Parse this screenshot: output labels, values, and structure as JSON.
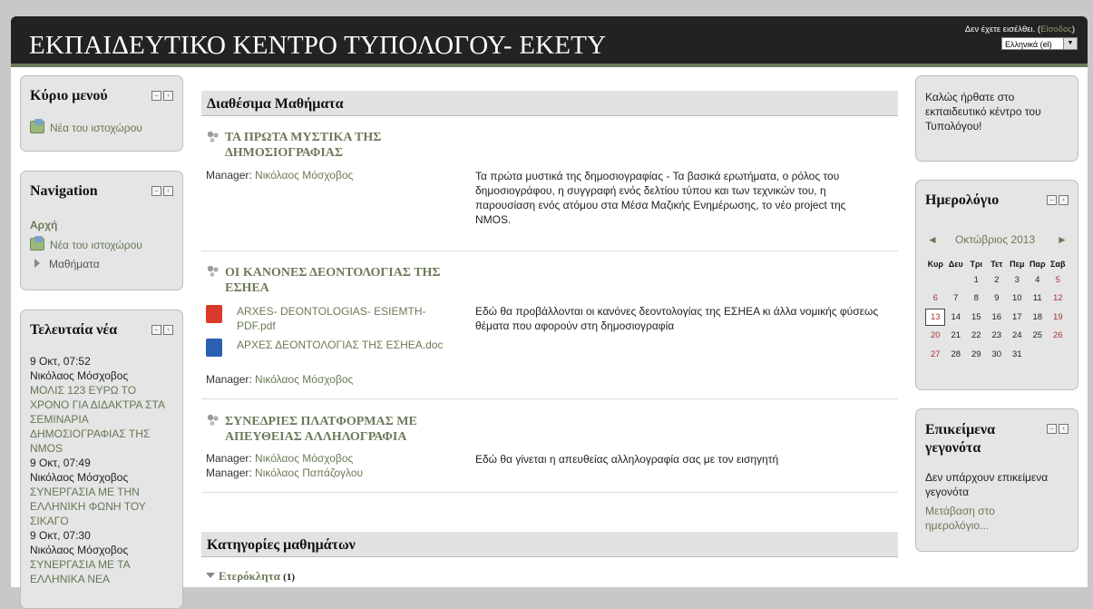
{
  "header": {
    "title": "ΕΚΠΑΙΔΕΥΤΙΚΟ ΚΕΝΤΡΟ ΤΥΠΟΛΟΓΟΥ- ΕΚΕΤΥ",
    "login_text": "Δεν έχετε εισέλθει. (",
    "login_link": "Είσοδος",
    "login_close": ")",
    "language": "Ελληνικά (el)"
  },
  "main_menu": {
    "title": "Κύριο μενού",
    "items": [
      "Νέα του ιστοχώρου"
    ]
  },
  "navigation": {
    "title": "Navigation",
    "home": "Αρχή",
    "items": [
      "Νέα του ιστοχώρου",
      "Μαθήματα"
    ]
  },
  "latest_news": {
    "title": "Τελευταία νέα",
    "posts": [
      {
        "date": "9 Οκτ, 07:52",
        "author": "Νικόλαος Μόσχοβος",
        "headline": "ΜΟΛΙΣ 123 ΕΥΡΩ ΤΟ ΧΡΟΝΟ ΓΙΑ ΔΙΔΑΚΤΡΑ ΣΤΑ ΣΕΜΙΝΑΡΙΑ ΔΗΜΟΣΙΟΓΡΑΦΙΑΣ ΤΗΣ ΝΜΟS"
      },
      {
        "date": "9 Οκτ, 07:49",
        "author": "Νικόλαος Μόσχοβος",
        "headline": "ΣΥΝΕΡΓΑΣΙΑ ΜΕ ΤΗΝ ΕΛΛΗΝΙΚΗ ΦΩΝΗ ΤΟΥ ΣΙΚΑΓΟ"
      },
      {
        "date": "9 Οκτ, 07:30",
        "author": "Νικόλαος Μόσχοβος",
        "headline": "ΣΥΝΕΡΓΑΣΙΑ ΜΕ ΤΑ ΕΛΛΗΝΙΚΑ ΝΕΑ"
      }
    ]
  },
  "courses": {
    "heading": "Διαθέσιμα Μαθήματα",
    "items": [
      {
        "title": "ΤΑ ΠΡΩΤΑ ΜΥΣΤΙΚΑ ΤΗΣ ΔΗΜΟΣΙΟΓΡΑΦΙΑΣ",
        "manager_label": "Manager:",
        "managers": [
          "Νικόλαος Μόσχοβος"
        ],
        "summary": "Τα πρώτα μυστικά της δημοσιογραφίας - Τα βασικά ερωτήματα, ο ρόλος του δημοσιογράφου, η συγγραφή ενός δελτίου τύπου και των τεχνικών του, η παρουσίαση ενός ατόμου στα Μέσα Μαζικής Ενημέρωσης, το νέο project της NMOS."
      },
      {
        "title": "ΟΙ ΚΑΝΟΝΕΣ ΔΕΟΝΤΟΛΟΓΙΑΣ ΤΗΣ ΕΣΗΕΑ",
        "files": [
          "ARXES- DEONTOLOGIAS- ESIEMTH-PDF.pdf",
          "ΑΡΧΕΣ ΔΕΟΝΤΟΛΟΓΙΑΣ ΤΗΣ ΕΣΗΕΑ.doc"
        ],
        "manager_label": "Manager:",
        "managers": [
          "Νικόλαος Μόσχοβος"
        ],
        "summary": "Εδώ θα προβάλλονται οι κανόνες δεοντολογίας της ΕΣΗΕΑ κι άλλα νομικής φύσεως θέματα που αφορούν στη δημοσιογραφία"
      },
      {
        "title": "ΣΥΝΕΔΡΙΕΣ ΠΛΑΤΦΟΡΜΑΣ ΜΕ ΑΠΕΥΘΕΙΑΣ ΑΛΛΗΛΟΓΡΑΦΙΑ",
        "manager_label": "Manager:",
        "managers": [
          "Νικόλαος Μόσχοβος",
          "Νικόλαος Παπάζογλου"
        ],
        "summary": "Εδώ θα γίνεται η απευθείας αλληλογραφία σας με τον εισηγητή"
      }
    ]
  },
  "categories": {
    "heading": "Κατηγορίες μαθημάτων",
    "items": [
      {
        "name": "Ετερόκλητα",
        "count": "(1)"
      }
    ]
  },
  "welcome": {
    "text": "Καλώς ήρθατε στο εκπαιδευτικό κέντρο του Τυπολόγου!"
  },
  "calendar": {
    "title": "Ημερολόγιο",
    "month": "Οκτώβριος 2013",
    "prev": "◄",
    "next": "►",
    "weekdays": [
      "Κυρ",
      "Δευ",
      "Τρι",
      "Τετ",
      "Πεμ",
      "Παρ",
      "Σαβ"
    ],
    "weeks": [
      [
        "",
        "",
        "1",
        "2",
        "3",
        "4",
        "5"
      ],
      [
        "6",
        "7",
        "8",
        "9",
        "10",
        "11",
        "12"
      ],
      [
        "13",
        "14",
        "15",
        "16",
        "17",
        "18",
        "19"
      ],
      [
        "20",
        "21",
        "22",
        "23",
        "24",
        "25",
        "26"
      ],
      [
        "27",
        "28",
        "29",
        "30",
        "31",
        "",
        ""
      ]
    ],
    "today": "13",
    "weekend_color": "#aa3333"
  },
  "upcoming": {
    "title": "Επικείμενα γεγονότα",
    "text": "Δεν υπάρχουν επικείμενα γεγονότα",
    "link": "Μετάβαση στο ημερολόγιο..."
  },
  "colors": {
    "accent": "#6b7a58",
    "header_bg": "#222222",
    "block_bg": "#e5e5e5"
  }
}
